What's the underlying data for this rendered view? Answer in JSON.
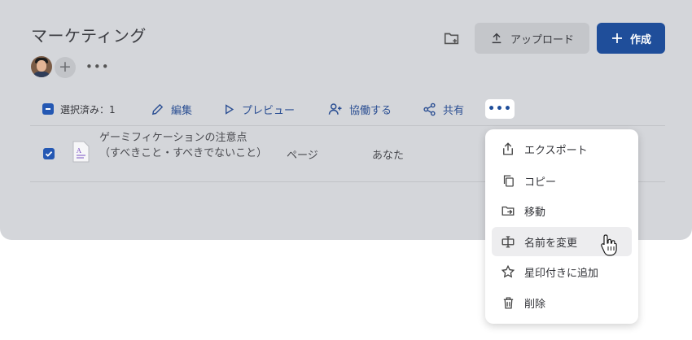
{
  "header": {
    "title": "マーケティング",
    "upload_label": "アップロード",
    "create_label": "作成"
  },
  "toolbar": {
    "selected_label": "選択済み：1",
    "edit_label": "編集",
    "preview_label": "プレビュー",
    "collaborate_label": "協働する",
    "share_label": "共有"
  },
  "rows": [
    {
      "name": "ゲーミフィケーションの注意点（すべきこと・すべきでないこと）",
      "type": "ページ",
      "owner": "あなた"
    }
  ],
  "menu": {
    "items": [
      {
        "label": "エクスポート",
        "icon": "export-icon"
      },
      {
        "label": "コピー",
        "icon": "copy-icon"
      },
      {
        "label": "移動",
        "icon": "move-icon"
      },
      {
        "label": "名前を変更",
        "icon": "rename-icon"
      },
      {
        "label": "星印付きに追加",
        "icon": "star-icon"
      },
      {
        "label": "削除",
        "icon": "trash-icon"
      }
    ]
  },
  "colors": {
    "primary": "#1f4e9a",
    "panel_bg": "#d4d6da",
    "link": "#2b4f93"
  }
}
